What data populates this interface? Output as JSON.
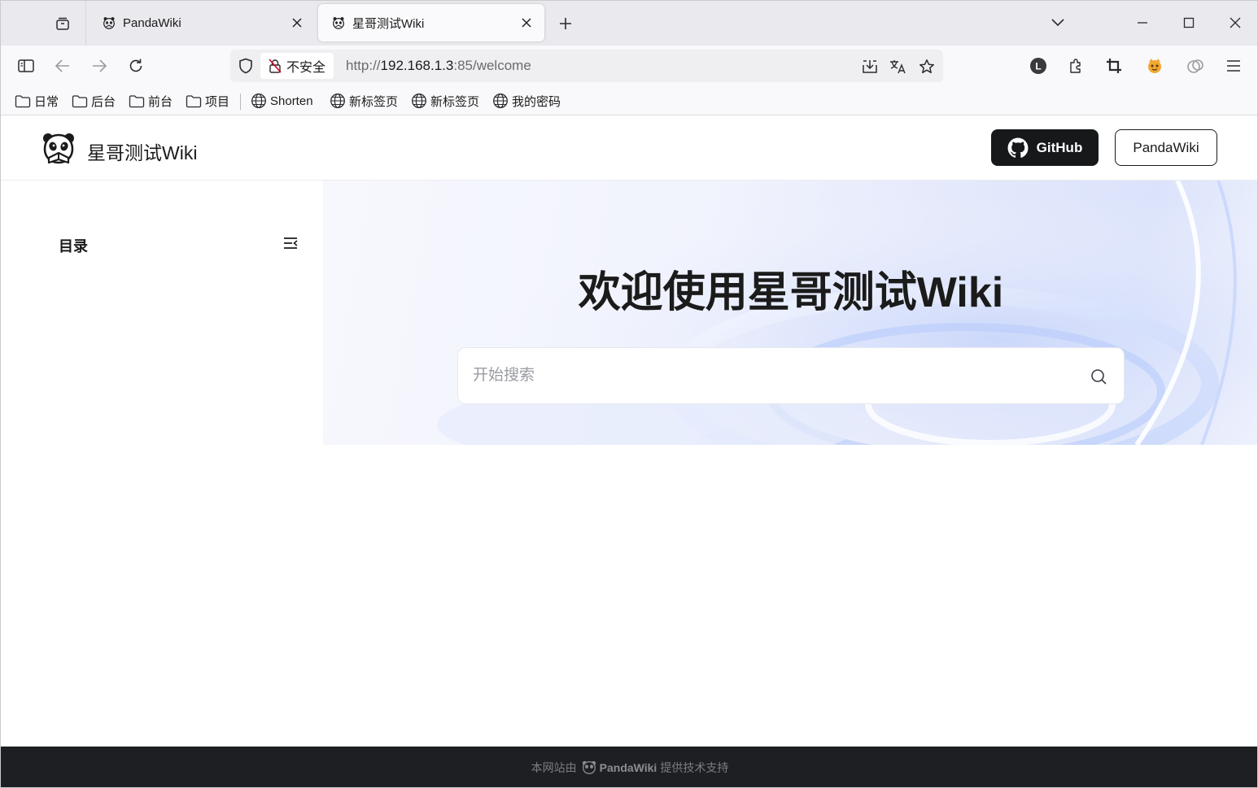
{
  "browser": {
    "tabs": [
      {
        "title": "PandaWiki",
        "active": false
      },
      {
        "title": "星哥测试Wiki",
        "active": true
      }
    ],
    "address": {
      "security_label": "不安全",
      "url_prefix": "http://",
      "url_host": "192.168.1.3",
      "url_rest": ":85/welcome"
    },
    "bookmarks": [
      {
        "label": "日常",
        "type": "folder"
      },
      {
        "label": "后台",
        "type": "folder"
      },
      {
        "label": "前台",
        "type": "folder"
      },
      {
        "label": "项目",
        "type": "folder"
      },
      {
        "label": "Shorten",
        "type": "link"
      },
      {
        "label": "新标签页",
        "type": "link"
      },
      {
        "label": "新标签页",
        "type": "link"
      },
      {
        "label": "我的密码",
        "type": "link"
      }
    ]
  },
  "site": {
    "name": "星哥测试Wiki",
    "github_label": "GitHub",
    "pandawiki_label": "PandaWiki"
  },
  "sidebar": {
    "title": "目录"
  },
  "hero": {
    "title": "欢迎使用星哥测试Wiki",
    "search_placeholder": "开始搜索"
  },
  "footer": {
    "prefix": "本网站由",
    "brand": "PandaWiki",
    "suffix": "提供技术支持"
  },
  "colors": {
    "github_button": "#16181a",
    "footer_bg": "#1e1f22",
    "tabbar_bg": "#e9e9ee"
  }
}
